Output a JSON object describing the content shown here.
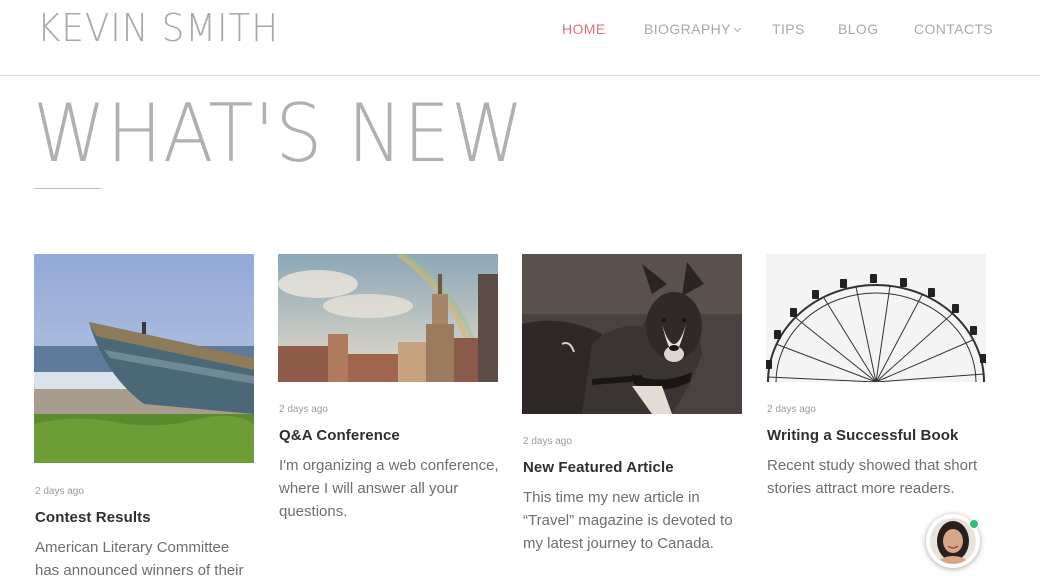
{
  "header": {
    "logo": "KEVIN SMITH",
    "nav": [
      {
        "label": "HOME",
        "active": true
      },
      {
        "label": "BIOGRAPHY",
        "has_dropdown": true
      },
      {
        "label": "TIPS"
      },
      {
        "label": "BLOG"
      },
      {
        "label": "CONTACTS"
      }
    ]
  },
  "main": {
    "title": "WHAT'S NEW",
    "posts": [
      {
        "date": "2 days ago",
        "title": "Contest Results",
        "text": "American Literary Committee has announced winners of their",
        "image": "boat-on-beach-photo"
      },
      {
        "date": "2 days ago",
        "title": "Q&A Conference",
        "text": "I'm organizing a web conference, where I will answer all your questions.",
        "image": "city-skyline-rainbow-photo"
      },
      {
        "date": "2 days ago",
        "title": "New Featured Article",
        "text": "This time my new article in “Travel” magazine is devoted to my latest journey to Canada.",
        "image": "husky-dog-photo"
      },
      {
        "date": "2 days ago",
        "title": "Writing a Successful Book",
        "text": "Recent study showed that short stories attract more readers.",
        "image": "ferris-wheel-photo"
      }
    ]
  },
  "chat": {
    "icon": "chat-avatar-icon",
    "status": "online",
    "status_color": "#2dbf73"
  },
  "colors": {
    "accent": "#d9737d",
    "nav": "#a9a9a9",
    "title": "#b0b0b0"
  }
}
